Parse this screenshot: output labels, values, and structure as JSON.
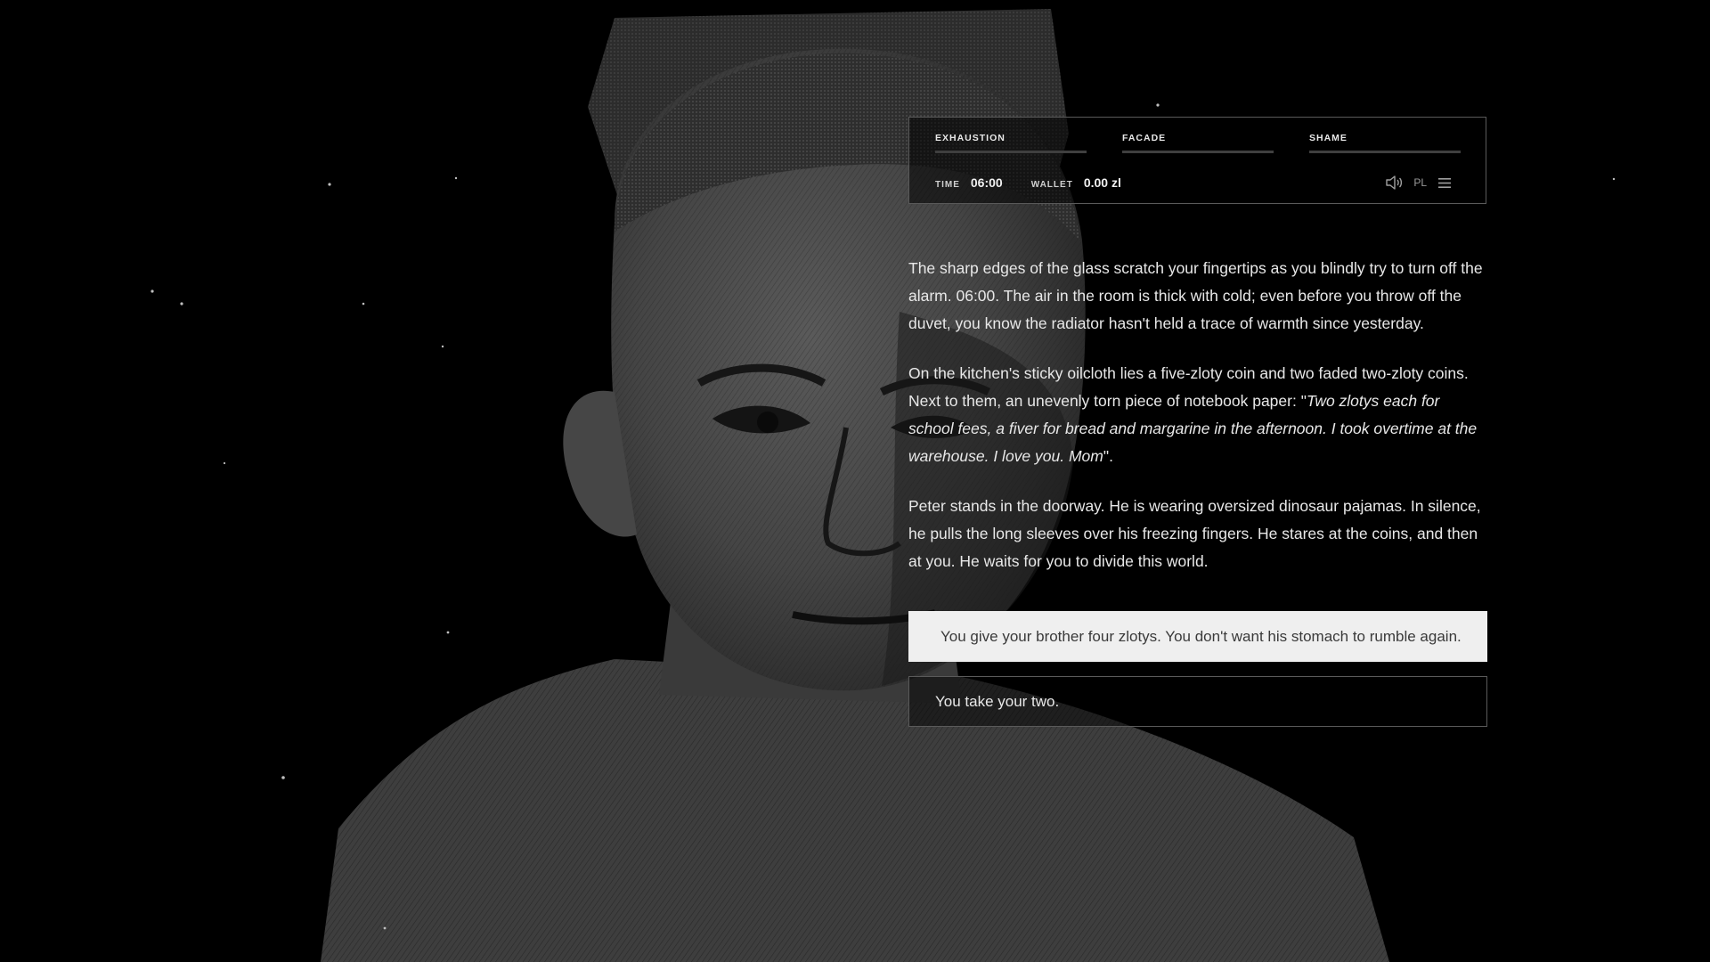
{
  "hud": {
    "stats": [
      {
        "label": "EXHAUSTION",
        "level": 0
      },
      {
        "label": "FACADE",
        "level": 0
      },
      {
        "label": "SHAME",
        "level": 0
      }
    ],
    "time_label": "TIME",
    "time_value": "06:00",
    "wallet_label": "WALLET",
    "wallet_value": "0.00 zl",
    "language": "PL",
    "icons": {
      "sound": "speaker-icon",
      "menu": "hamburger-menu-icon"
    }
  },
  "story": {
    "p1": "The sharp edges of the glass scratch your fingertips as you blindly try to turn off the alarm. 06:00. The air in the room is thick with cold; even before you throw off the duvet, you know the radiator hasn't held a trace of warmth since yesterday.",
    "p2_lead": "On the kitchen's sticky oilcloth lies a five-zloty coin and two faded two-zloty coins. Next to them, an unevenly torn piece of notebook paper: \"",
    "p2_note": "Two zlotys each for school fees, a fiver for bread and margarine in the afternoon. I took overtime at the warehouse. I love you. Mom",
    "p2_tail": "\".",
    "p3": "Peter stands in the doorway. He is wearing oversized dinosaur pajamas. In silence, he pulls the long sleeves over his freezing fingers. He stares at the coins, and then at you. He waits for you to divide this world."
  },
  "choices": [
    {
      "label": "You give your brother four zlotys. You don't want his stomach to rumble again."
    },
    {
      "label": "You take your two."
    }
  ],
  "colors": {
    "background": "#000000",
    "portrait_mid": "#4a4a4a",
    "text": "#e8e8e8",
    "choice_selected_bg": "#efefef"
  }
}
